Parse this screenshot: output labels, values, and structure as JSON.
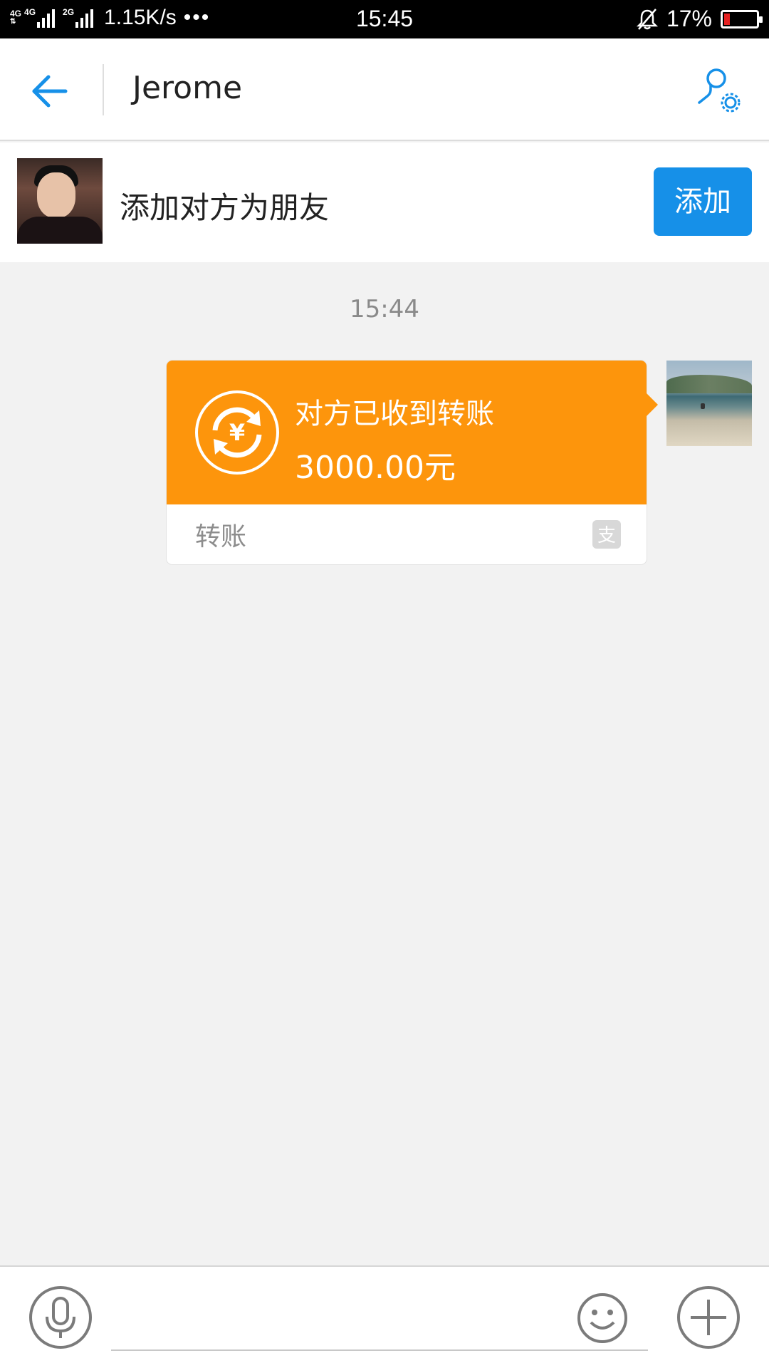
{
  "status_bar": {
    "network1": "4G",
    "network2": "4G",
    "network3": "2G",
    "speed": "1.15K/s",
    "more": "•••",
    "time": "15:45",
    "battery": "17%",
    "icons": [
      "signal-icon",
      "alarm-off-icon",
      "battery-low-icon"
    ]
  },
  "header": {
    "title": "Jerome",
    "back_icon": "arrow-left-icon",
    "settings_icon": "contact-settings-icon",
    "accent": "#1690e8"
  },
  "add_friend": {
    "text": "添加对方为朋友",
    "button_label": "添加"
  },
  "chat": {
    "timestamp": "15:44",
    "messages": [
      {
        "type": "transfer",
        "status": "对方已收到转账",
        "amount": "3000.00元",
        "label": "转账",
        "bubble_color": "#fd950c",
        "icon": "transfer-yuan-icon",
        "brand_icon": "alipay-icon"
      }
    ]
  },
  "input_bar": {
    "placeholder": "",
    "voice_icon": "microphone-icon",
    "emoji_icon": "smiley-icon",
    "plus_icon": "plus-icon"
  }
}
